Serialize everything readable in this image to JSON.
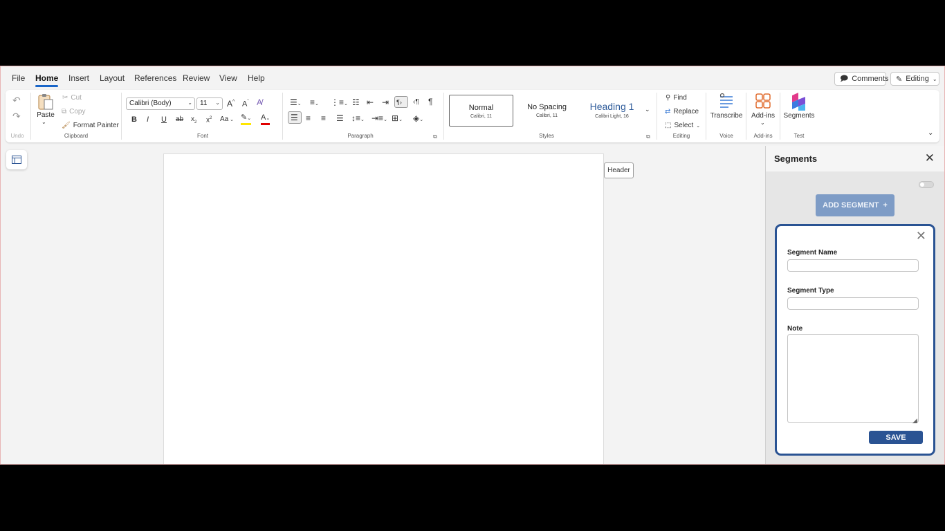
{
  "menu": {
    "tabs": [
      {
        "label": "File"
      },
      {
        "label": "Home"
      },
      {
        "label": "Insert"
      },
      {
        "label": "Layout"
      },
      {
        "label": "References"
      },
      {
        "label": "Review"
      },
      {
        "label": "View"
      },
      {
        "label": "Help"
      }
    ],
    "active_tab": "Home",
    "comments_label": "Comments",
    "editing_label": "Editing"
  },
  "ribbon": {
    "undo": {
      "group_label": "Undo"
    },
    "clipboard": {
      "paste_label": "Paste",
      "cut_label": "Cut",
      "copy_label": "Copy",
      "format_painter_label": "Format Painter",
      "group_label": "Clipboard"
    },
    "font": {
      "font_name": "Calibri (Body)",
      "font_size": "11",
      "group_label": "Font",
      "change_case_label": "Aa"
    },
    "paragraph": {
      "group_label": "Paragraph"
    },
    "styles": {
      "items": [
        {
          "name": "Normal",
          "sub": "Calibri, 11"
        },
        {
          "name": "No Spacing",
          "sub": "Calibri, 11"
        },
        {
          "name": "Heading 1",
          "sub": "Calibri Light, 16"
        }
      ],
      "group_label": "Styles"
    },
    "editing": {
      "find_label": "Find",
      "replace_label": "Replace",
      "select_label": "Select",
      "group_label": "Editing"
    },
    "voice": {
      "transcribe_label": "Transcribe",
      "group_label": "Voice"
    },
    "addins": {
      "addins_label": "Add-ins",
      "group_label": "Add-ins"
    },
    "test": {
      "segments_label": "Segments",
      "group_label": "Test"
    }
  },
  "document": {
    "header_tooltip": "Header"
  },
  "pane": {
    "title": "Segments",
    "add_segment_label": "ADD SEGMENT",
    "add_segment_icon": "+",
    "form": {
      "name_label": "Segment Name",
      "name_value": "",
      "type_label": "Segment Type",
      "type_value": "",
      "note_label": "Note",
      "note_value": "",
      "save_label": "SAVE"
    }
  },
  "colors": {
    "accent_blue": "#1a66c8",
    "card_border": "#2a5393",
    "save_button": "#2a5393",
    "add_segment_button": "#7e9cc6"
  }
}
